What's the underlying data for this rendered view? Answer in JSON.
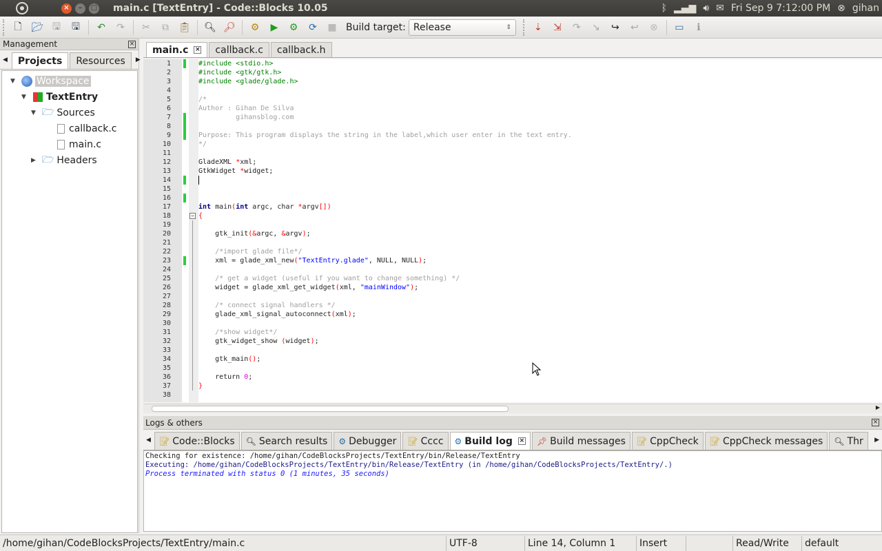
{
  "topbar": {
    "window_title": "main.c [TextEntry] - Code::Blocks 10.05",
    "datetime": "Fri Sep  9  7:12:00 PM",
    "user": "gihan",
    "icons": [
      "ubuntu-logo-icon",
      "close-window-icon",
      "minimize-icon",
      "maximize-icon",
      "bluetooth-icon",
      "network-icon",
      "volume-icon",
      "mail-icon",
      "session-icon"
    ]
  },
  "toolbar": {
    "build_target_label": "Build target:",
    "build_target_value": "Release"
  },
  "management": {
    "title": "Management",
    "tabs": [
      "Projects",
      "Resources"
    ],
    "tree": {
      "workspace": "Workspace",
      "project": "TextEntry",
      "sources": "Sources",
      "files": [
        "callback.c",
        "main.c"
      ],
      "headers": "Headers"
    }
  },
  "editor": {
    "tabs": [
      "main.c",
      "callback.c",
      "callback.h"
    ],
    "active_tab": "main.c",
    "line_numbers": [
      "1",
      "2",
      "3",
      "4",
      "5",
      "6",
      "7",
      "8",
      "9",
      "10",
      "11",
      "12",
      "13",
      "14",
      "15",
      "16",
      "17",
      "18",
      "19",
      "20",
      "21",
      "22",
      "23",
      "24",
      "25",
      "26",
      "27",
      "28",
      "29",
      "30",
      "31",
      "32",
      "33",
      "34",
      "35",
      "36",
      "37",
      "38"
    ],
    "code_lines": [
      "#include <stdio.h>",
      "#include <gtk/gtk.h>",
      "#include <glade/glade.h>",
      "",
      "/*",
      "Author : Gihan De Silva",
      "         gihansblog.com",
      "",
      "Purpose: This program displays the string in the label,which user enter in the text entry.",
      "*/",
      "",
      "GladeXML *xml;",
      "GtkWidget *widget;",
      "",
      "",
      "",
      "int main(int argc, char *argv[])",
      "{",
      "",
      "    gtk_init(&argc, &argv);",
      "",
      "    /*import glade file*/",
      "    xml = glade_xml_new(\"TextEntry.glade\", NULL, NULL);",
      "",
      "    /* get a widget (useful if you want to change something) */",
      "    widget = glade_xml_get_widget(xml, \"mainWindow\");",
      "",
      "    /* connect signal handlers */",
      "    glade_xml_signal_autoconnect(xml);",
      "",
      "    /*show widget*/",
      "    gtk_widget_show (widget);",
      "",
      "    gtk_main();",
      "",
      "    return 0;",
      "}",
      ""
    ],
    "changed_lines": [
      1,
      7,
      8,
      9,
      14,
      16,
      23
    ]
  },
  "logs": {
    "title": "Logs & others",
    "tabs": [
      "Code::Blocks",
      "Search results",
      "Debugger",
      "Cccc",
      "Build log",
      "Build messages",
      "CppCheck",
      "CppCheck messages",
      "Thr"
    ],
    "active_tab": "Build log",
    "lines": [
      "Checking for existence: /home/gihan/CodeBlocksProjects/TextEntry/bin/Release/TextEntry",
      "Executing: /home/gihan/CodeBlocksProjects/TextEntry/bin/Release/TextEntry  (in /home/gihan/CodeBlocksProjects/TextEntry/.)",
      "Process terminated with status 0 (1 minutes, 35 seconds)"
    ]
  },
  "statusbar": {
    "path": "/home/gihan/CodeBlocksProjects/TextEntry/main.c",
    "encoding": "UTF-8",
    "position": "Line 14, Column 1",
    "mode": "Insert",
    "access": "Read/Write",
    "profile": "default"
  },
  "colors": {
    "topbar_bg": "#3c3b37",
    "change_marker": "#2ecc40",
    "close_btn": "#e05a2b",
    "keyword": "#00008b",
    "preprocessor": "#008000",
    "comment": "#a0a0a0",
    "string": "#0000ff"
  }
}
